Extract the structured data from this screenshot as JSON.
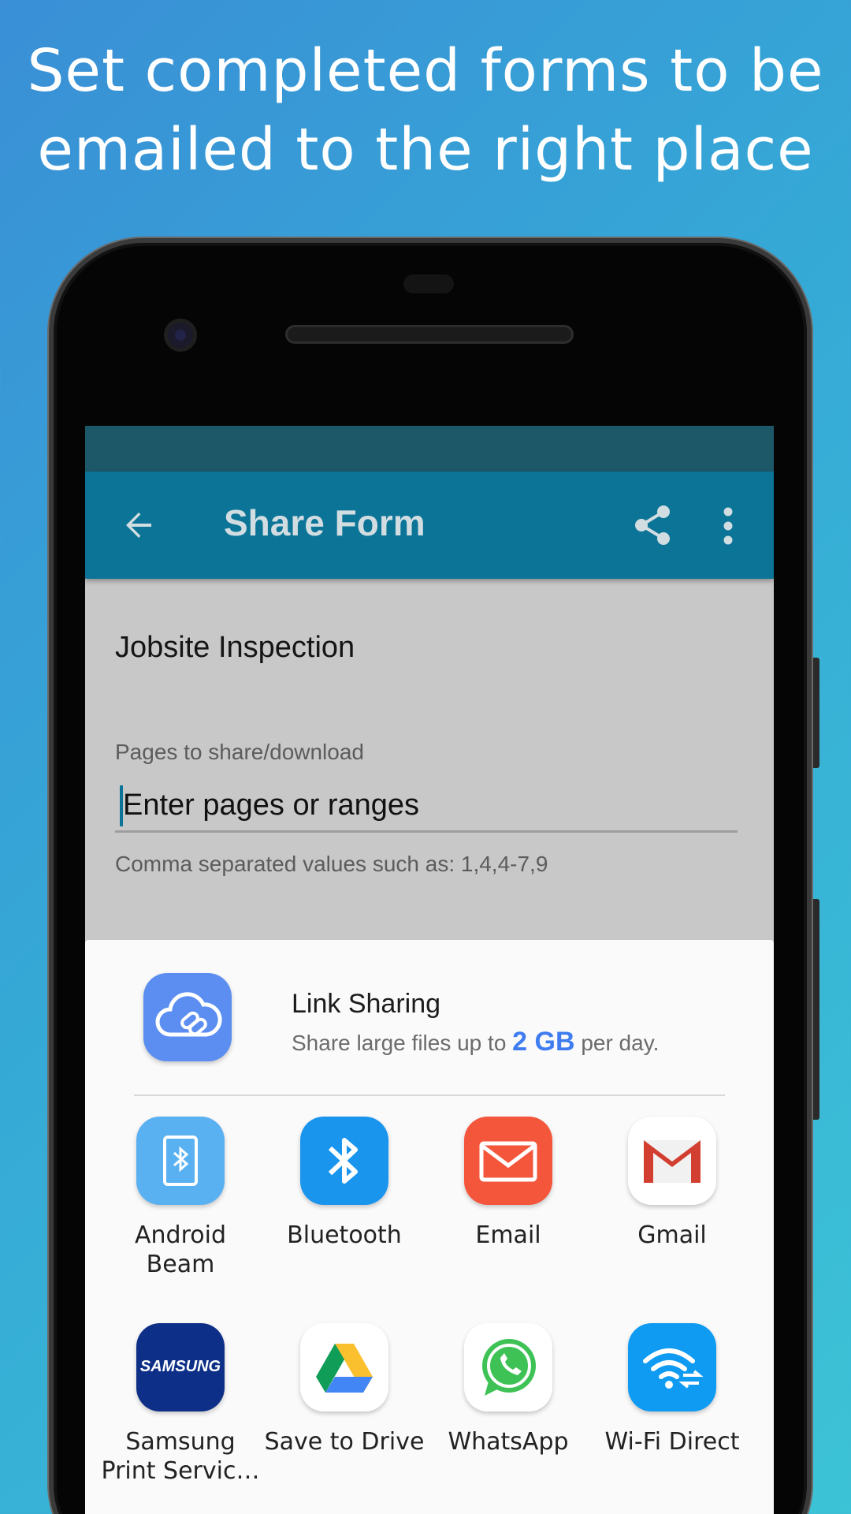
{
  "headline": {
    "line1": "Set completed forms to be",
    "line2": "emailed to the right place"
  },
  "appbar": {
    "title": "Share Form",
    "back_icon": "arrow-back-icon",
    "share_icon": "share-icon",
    "more_icon": "more-vert-icon"
  },
  "form": {
    "name": "Jobsite Inspection",
    "pages_label": "Pages to share/download",
    "pages_placeholder": "Enter pages or ranges",
    "pages_value": "",
    "pages_hint": "Comma separated values such as: 1,4,4-7,9"
  },
  "share_sheet": {
    "link_sharing": {
      "title": "Link Sharing",
      "subtitle_before": "Share large files up to",
      "subtitle_highlight": "2 GB",
      "subtitle_after": "per day.",
      "icon": "cloud-link-icon"
    },
    "apps": [
      {
        "label_line1": "Android",
        "label_line2": "Beam",
        "icon": "android-beam-icon",
        "color": "#5ab1f2"
      },
      {
        "label_line1": "Bluetooth",
        "label_line2": "",
        "icon": "bluetooth-icon",
        "color": "#1a95ee"
      },
      {
        "label_line1": "Email",
        "label_line2": "",
        "icon": "email-icon",
        "color": "#f4563c"
      },
      {
        "label_line1": "Gmail",
        "label_line2": "",
        "icon": "gmail-icon",
        "color": "#ffffff"
      },
      {
        "label_line1": "Samsung",
        "label_line2": "Print Servic…",
        "icon": "samsung-print-icon",
        "color": "#0d2f87",
        "badge": "SAMSUNG"
      },
      {
        "label_line1": "Save to Drive",
        "label_line2": "",
        "icon": "google-drive-icon",
        "color": "#ffffff"
      },
      {
        "label_line1": "WhatsApp",
        "label_line2": "",
        "icon": "whatsapp-icon",
        "color": "#ffffff"
      },
      {
        "label_line1": "Wi-Fi Direct",
        "label_line2": "",
        "icon": "wifi-direct-icon",
        "color": "#0f9bf2"
      }
    ]
  }
}
